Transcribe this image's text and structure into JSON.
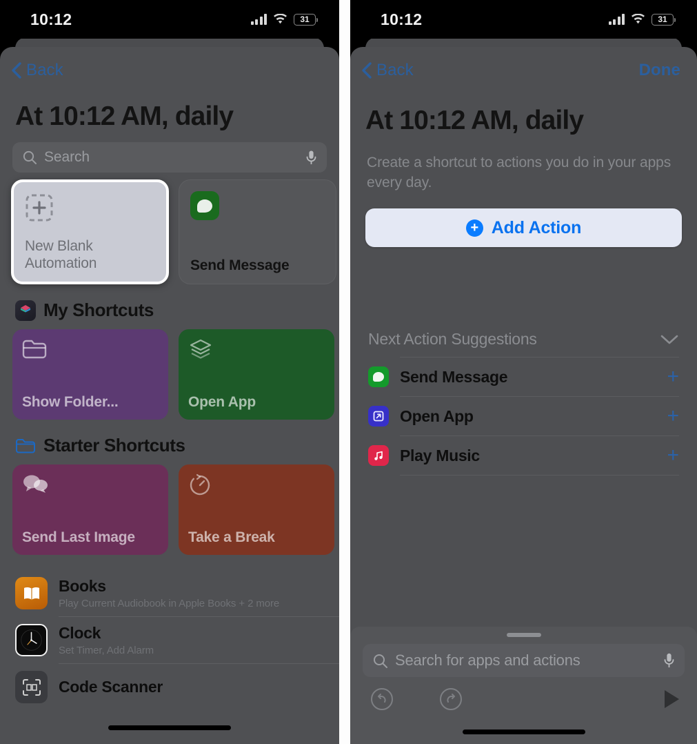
{
  "status_bar": {
    "time": "10:12",
    "battery": "31",
    "signal_icon": "cellular-bars-icon",
    "wifi_icon": "wifi-icon",
    "battery_icon": "battery-icon"
  },
  "left_panel": {
    "nav": {
      "back_label": "Back",
      "back_icon": "chevron-left-icon"
    },
    "title": "At 10:12 AM, daily",
    "search": {
      "placeholder": "Search",
      "search_icon": "search-icon",
      "mic_icon": "microphone-icon"
    },
    "top_cards": [
      {
        "label": "New Blank Automation",
        "icon": "add-blank-automation-icon",
        "selected": true
      },
      {
        "label": "Send Message",
        "icon": "messages-app-icon",
        "selected": false
      }
    ],
    "sections": [
      {
        "title": "My Shortcuts",
        "icon": "shortcuts-app-icon",
        "tiles": [
          {
            "label": "Show Folder...",
            "icon": "folder-icon",
            "color": "#5c3a72"
          },
          {
            "label": "Open App",
            "icon": "layers-icon",
            "color": "#1d5a28"
          },
          {
            "label": "",
            "icon": "",
            "color": "#7a2a2f"
          }
        ]
      },
      {
        "title": "Starter Shortcuts",
        "icon": "folder-outline-icon",
        "tiles": [
          {
            "label": "Send Last Image",
            "icon": "chat-bubbles-icon",
            "color": "#6b2f58"
          },
          {
            "label": "Take a Break",
            "icon": "timer-icon",
            "color": "#7d3523"
          },
          {
            "label": "",
            "icon": "",
            "color": "#1f3166"
          }
        ]
      }
    ],
    "apps": [
      {
        "name": "Books",
        "detail": "Play Current Audiobook in Apple Books + 2 more",
        "icon": "books-app-icon"
      },
      {
        "name": "Clock",
        "detail": "Set Timer, Add Alarm",
        "icon": "clock-app-icon"
      },
      {
        "name": "Code Scanner",
        "detail": "",
        "icon": "code-scanner-icon"
      }
    ]
  },
  "right_panel": {
    "nav": {
      "back_label": "Back",
      "back_icon": "chevron-left-icon",
      "done_label": "Done"
    },
    "title": "At 10:12 AM, daily",
    "subtitle": "Create a shortcut to actions you do in your apps every day.",
    "add_action": {
      "label": "Add Action",
      "icon": "plus-circle-icon"
    },
    "suggestions_header": {
      "label": "Next Action Suggestions",
      "chevron_icon": "chevron-down-icon"
    },
    "suggestions": [
      {
        "label": "Send Message",
        "icon": "messages-app-icon",
        "color": "#149a2b",
        "add_icon": "plus-icon"
      },
      {
        "label": "Open App",
        "icon": "open-app-icon",
        "color": "#3730c8",
        "add_icon": "plus-icon"
      },
      {
        "label": "Play Music",
        "icon": "music-app-icon",
        "color": "#e0264a",
        "add_icon": "plus-icon"
      }
    ],
    "bottom_sheet": {
      "grabber": "drag-handle",
      "search": {
        "placeholder": "Search for apps and actions",
        "search_icon": "search-icon",
        "mic_icon": "microphone-icon"
      },
      "tools": [
        {
          "name": "undo-icon"
        },
        {
          "name": "redo-icon"
        },
        {
          "name": "play-icon"
        }
      ]
    }
  },
  "colors": {
    "accent_blue": "#0a7cff",
    "nav_blue": "#2b5f9e",
    "sheet_bg": "#4f5053"
  }
}
